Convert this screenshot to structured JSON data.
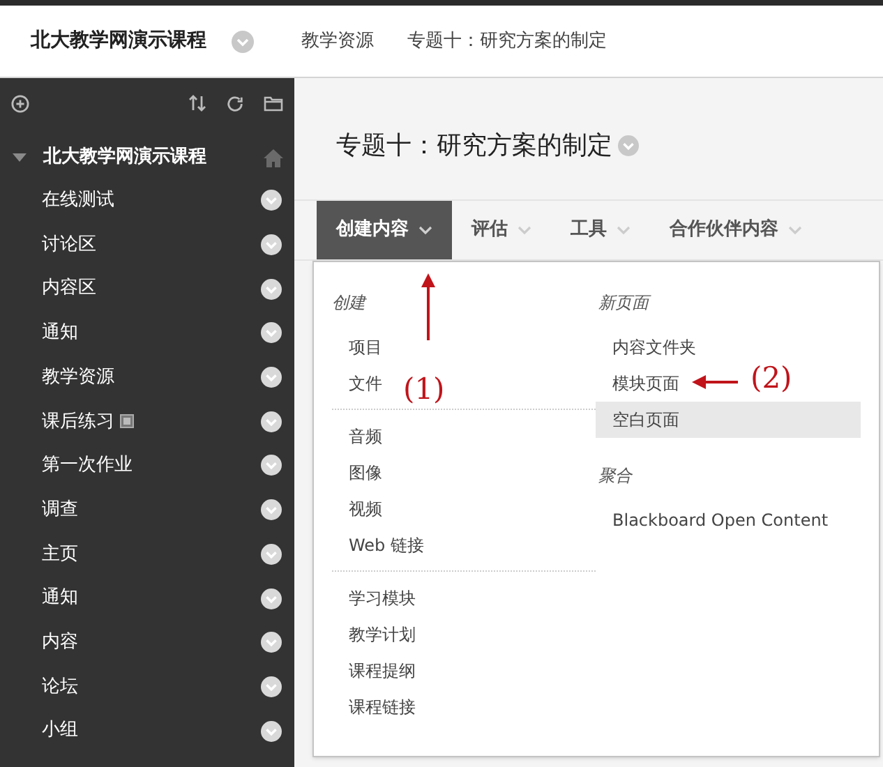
{
  "header": {
    "course_title": "北大教学网演示课程",
    "breadcrumbs": [
      "教学资源",
      "专题十：研究方案的制定"
    ]
  },
  "sidebar": {
    "title": "北大教学网演示课程",
    "items": [
      {
        "label": "在线测试",
        "flag_icon": false
      },
      {
        "label": "讨论区",
        "flag_icon": false
      },
      {
        "label": "内容区",
        "flag_icon": false
      },
      {
        "label": "通知",
        "flag_icon": false
      },
      {
        "label": "教学资源",
        "flag_icon": false
      },
      {
        "label": "课后练习",
        "flag_icon": true
      },
      {
        "label": "第一次作业",
        "flag_icon": false
      },
      {
        "label": "调查",
        "flag_icon": false
      },
      {
        "label": "主页",
        "flag_icon": false
      },
      {
        "label": "通知",
        "flag_icon": false
      },
      {
        "label": "内容",
        "flag_icon": false
      },
      {
        "label": "论坛",
        "flag_icon": false
      },
      {
        "label": "小组",
        "flag_icon": false
      }
    ]
  },
  "page_title": "专题十：研究方案的制定",
  "tabs": [
    {
      "label": "创建内容",
      "selected": true
    },
    {
      "label": "评估",
      "selected": false
    },
    {
      "label": "工具",
      "selected": false
    },
    {
      "label": "合作伙伴内容",
      "selected": false
    }
  ],
  "menu": {
    "columns": [
      {
        "sections": [
          {
            "heading": "创建",
            "items": [
              {
                "label": "项目",
                "highlighted": false
              },
              {
                "label": "文件",
                "highlighted": false
              }
            ]
          },
          {
            "items": [
              {
                "label": "音频",
                "highlighted": false
              },
              {
                "label": "图像",
                "highlighted": false
              },
              {
                "label": "视频",
                "highlighted": false
              },
              {
                "label": "Web 链接",
                "highlighted": false
              }
            ]
          },
          {
            "items": [
              {
                "label": "学习模块",
                "highlighted": false
              },
              {
                "label": "教学计划",
                "highlighted": false
              },
              {
                "label": "课程提纲",
                "highlighted": false
              },
              {
                "label": "课程链接",
                "highlighted": false
              }
            ]
          }
        ]
      },
      {
        "sections": [
          {
            "heading": "新页面",
            "items": [
              {
                "label": "内容文件夹",
                "highlighted": false
              },
              {
                "label": "模块页面",
                "highlighted": false
              },
              {
                "label": "空白页面",
                "highlighted": true
              }
            ]
          },
          {
            "heading": "聚合",
            "items": [
              {
                "label": "Blackboard Open Content",
                "highlighted": false
              }
            ]
          }
        ]
      }
    ]
  },
  "annotations": [
    {
      "label": "(1)"
    },
    {
      "label": "(2)"
    }
  ]
}
